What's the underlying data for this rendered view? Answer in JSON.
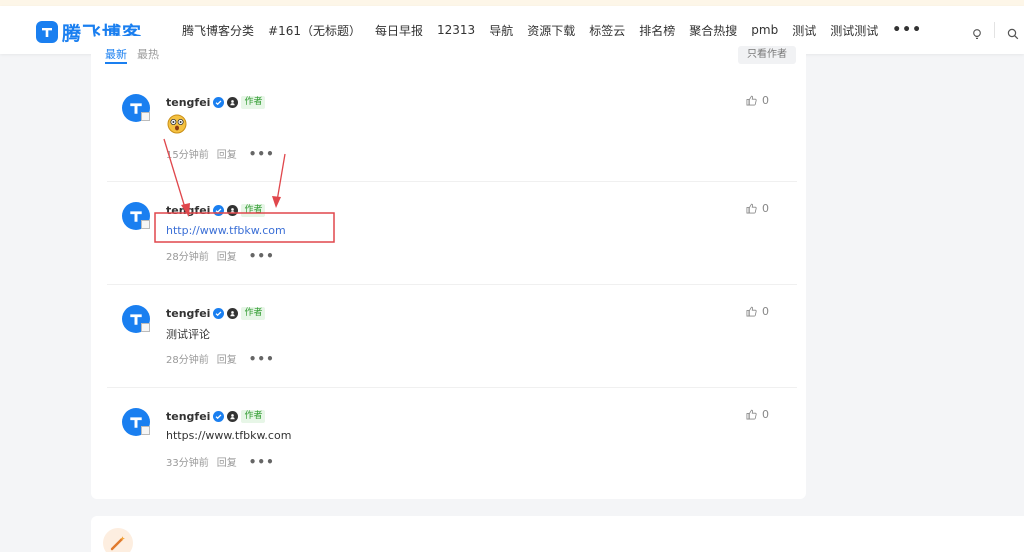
{
  "brand": {
    "name": "腾飞博客",
    "color": "#1a7ff0"
  },
  "nav": {
    "items": [
      "腾飞博客分类",
      "#161（无标题）",
      "每日早报",
      "12313",
      "导航",
      "资源下载",
      "标签云",
      "排名榜",
      "聚合热搜",
      "pmb",
      "测试",
      "测试测试"
    ],
    "more_icon": "more-dots-icon"
  },
  "header_icons": [
    "lightbulb-icon",
    "search-icon"
  ],
  "tabs": {
    "latest": "最新",
    "hottest": "最热",
    "author_only": "只看作者"
  },
  "comments": [
    {
      "author": "tengfei",
      "badge": "作者",
      "body": "",
      "body_type": "emoji",
      "emoji_icon": "shocked-emoji-icon",
      "time": "15分钟前",
      "reply": "回复",
      "likes": "0"
    },
    {
      "author": "tengfei",
      "badge": "作者",
      "body": "http://www.tfbkw.com",
      "body_type": "link",
      "time": "28分钟前",
      "reply": "回复",
      "likes": "0"
    },
    {
      "author": "tengfei",
      "badge": "作者",
      "body": "测试评论",
      "body_type": "text",
      "time": "28分钟前",
      "reply": "回复",
      "likes": "0"
    },
    {
      "author": "tengfei",
      "badge": "作者",
      "body": "https://www.tfbkw.com",
      "body_type": "text",
      "time": "33分钟前",
      "reply": "回复",
      "likes": "0"
    }
  ],
  "annotation_color": "#e0474c",
  "colors": {
    "accent": "#1a7ff0",
    "badge_green": "#2f9b2f",
    "link": "#3b6fd6"
  }
}
